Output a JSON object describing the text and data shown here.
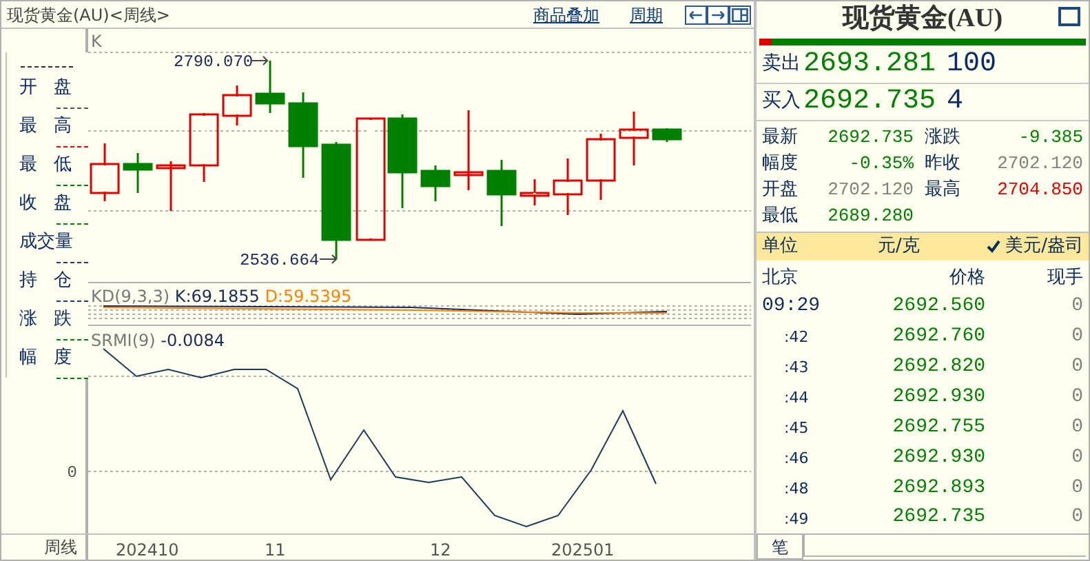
{
  "chart_window": {
    "title": "现货黄金(AU)<周线>",
    "links": [
      "商品叠加",
      "周期"
    ],
    "legend": [
      {
        "label": "开 盘",
        "color": "#555555"
      },
      {
        "label": "最 高",
        "color": "#e00000"
      },
      {
        "label": "最 低",
        "color": "#008000"
      },
      {
        "label": "收 盘",
        "color": "#008000"
      },
      {
        "label": "成交量",
        "color": "#1a3a6a"
      },
      {
        "label": "持 仓",
        "color": "#1a3a6a"
      },
      {
        "label": "涨 跌",
        "color": "#008000"
      },
      {
        "label": "幅 度",
        "color": "#008000"
      }
    ],
    "k_panel": {
      "label": "K",
      "high_label": "2790.070",
      "low_label": "2536.664"
    },
    "kd_panel": {
      "name": "KD(9,3,3)",
      "k": "K:69.1855",
      "d": "D:59.5395"
    },
    "srmi_panel": {
      "name": "SRMI(9)",
      "value": "-0.0084",
      "axis_label": "0"
    },
    "x_axis": {
      "period": "周线",
      "labels": [
        "202410",
        "11",
        "12",
        "202501"
      ]
    }
  },
  "quote_panel": {
    "title": "现货黄金(AU)",
    "ratio_bar": {
      "level": 0.04
    },
    "sell": {
      "label": "卖出",
      "price": "2693.281",
      "volume": "100"
    },
    "buy": {
      "label": "买入",
      "price": "2692.735",
      "volume": "4"
    },
    "fields": [
      {
        "label": "最新",
        "value": "2692.735",
        "color": "#008000"
      },
      {
        "label": "涨跌",
        "value": "-9.385",
        "color": "#008000"
      },
      {
        "label": "幅度",
        "value": "-0.35%",
        "color": "#008000"
      },
      {
        "label": "昨收",
        "value": "2702.120",
        "color": "#808080"
      },
      {
        "label": "开盘",
        "value": "2702.120",
        "color": "#808080"
      },
      {
        "label": "最高",
        "value": "2704.850",
        "color": "#e00000"
      },
      {
        "label": "最低",
        "value": "2689.280",
        "color": "#008000"
      }
    ],
    "unit": {
      "label": "单位",
      "options": [
        {
          "label": "元/克",
          "selected": false
        },
        {
          "label": "美元/盎司",
          "selected": true
        }
      ]
    },
    "ticks": {
      "columns": [
        "北京",
        "价格",
        "现手"
      ],
      "rows": [
        {
          "time": "09:29",
          "kind": "full",
          "price": "2692.560",
          "volume": "0"
        },
        {
          "time": ":42",
          "kind": "minute",
          "price": "2692.760",
          "volume": "0"
        },
        {
          "time": ":43",
          "kind": "minute",
          "price": "2692.820",
          "volume": "0"
        },
        {
          "time": ":44",
          "kind": "minute",
          "price": "2692.930",
          "volume": "0"
        },
        {
          "time": ":45",
          "kind": "minute",
          "price": "2692.755",
          "volume": "0"
        },
        {
          "time": ":46",
          "kind": "minute",
          "price": "2692.930",
          "volume": "0"
        },
        {
          "time": ":48",
          "kind": "minute",
          "price": "2692.893",
          "volume": "0"
        },
        {
          "time": ":49",
          "kind": "minute",
          "price": "2692.735",
          "volume": "0"
        }
      ]
    },
    "tabs": [
      {
        "label": "笔",
        "selected": true
      }
    ]
  }
}
